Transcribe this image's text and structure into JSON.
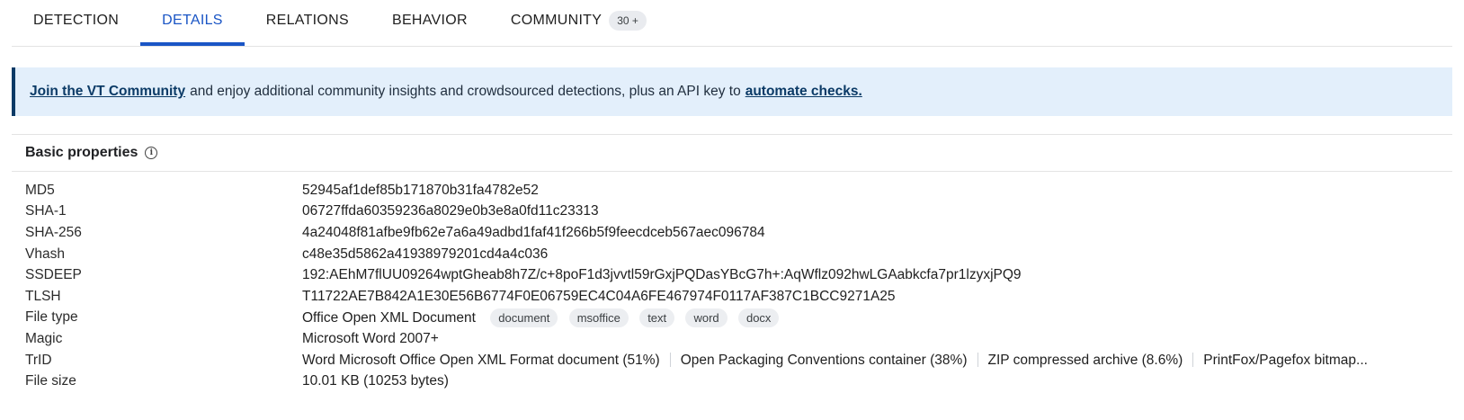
{
  "tabs": [
    {
      "label": "DETECTION"
    },
    {
      "label": "DETAILS"
    },
    {
      "label": "RELATIONS"
    },
    {
      "label": "BEHAVIOR"
    },
    {
      "label": "COMMUNITY",
      "badge": "30 +"
    }
  ],
  "active_tab": "DETAILS",
  "banner": {
    "link1": "Join the VT Community",
    "text": "and enjoy additional community insights and crowdsourced detections, plus an API key to",
    "link2": "automate checks."
  },
  "basic_properties": {
    "title": "Basic properties",
    "md5": {
      "label": "MD5",
      "value": "52945af1def85b171870b31fa4782e52"
    },
    "sha1": {
      "label": "SHA-1",
      "value": "06727ffda60359236a8029e0b3e8a0fd11c23313"
    },
    "sha256": {
      "label": "SHA-256",
      "value": "4a24048f81afbe9fb62e7a6a49adbd1faf41f266b5f9feecdceb567aec096784"
    },
    "vhash": {
      "label": "Vhash",
      "value": "c48e35d5862a41938979201cd4a4c036"
    },
    "ssdeep": {
      "label": "SSDEEP",
      "value": "192:AEhM7flUU09264wptGheab8h7Z/c+8poF1d3jvvtl59rGxjPQDasYBcG7h+:AqWflz092hwLGAabkcfa7pr1lzyxjPQ9"
    },
    "tlsh": {
      "label": "TLSH",
      "value": "T11722AE7B842A1E30E56B6774F0E06759EC4C04A6FE467974F0117AF387C1BCC9271A25"
    },
    "file_type": {
      "label": "File type",
      "value": "Office Open XML Document",
      "tags": [
        "document",
        "msoffice",
        "text",
        "word",
        "docx"
      ]
    },
    "magic": {
      "label": "Magic",
      "value": "Microsoft Word 2007+"
    },
    "trid": {
      "label": "TrID",
      "items": [
        "Word Microsoft Office Open XML Format document (51%)",
        "Open Packaging Conventions container (38%)",
        "ZIP compressed archive (8.6%)",
        "PrintFox/Pagefox bitmap..."
      ]
    },
    "file_size": {
      "label": "File size",
      "value": "10.01 KB (10253 bytes)"
    }
  },
  "colors": {
    "accent": "#1a55c5",
    "banner_bg": "#e3effb",
    "banner_border": "#0b3a66",
    "highlight_underline": "#e0262b"
  },
  "icons": {
    "info": "info-icon"
  }
}
